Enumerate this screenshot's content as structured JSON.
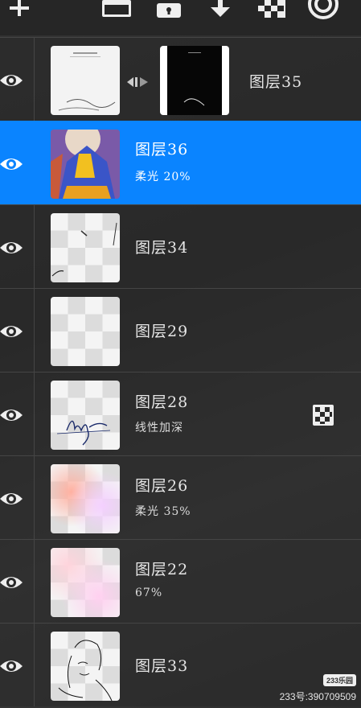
{
  "toolbar": {
    "icons": [
      "plus-icon",
      "layer-fill-icon",
      "lock-icon",
      "merge-down-icon",
      "checkerboard-icon",
      "spiral-icon"
    ]
  },
  "layers": [
    {
      "name": "图层35",
      "sub": "",
      "mask": true,
      "selected": false,
      "badge": false
    },
    {
      "name": "图层36",
      "sub": "柔光  20%",
      "mask": false,
      "selected": true,
      "badge": false
    },
    {
      "name": "图层34",
      "sub": "",
      "mask": false,
      "selected": false,
      "badge": false
    },
    {
      "name": "图层29",
      "sub": "",
      "mask": false,
      "selected": false,
      "badge": false
    },
    {
      "name": "图层28",
      "sub": "线性加深",
      "mask": false,
      "selected": false,
      "badge": true
    },
    {
      "name": "图层26",
      "sub": "柔光  35%",
      "mask": false,
      "selected": false,
      "badge": false
    },
    {
      "name": "图层22",
      "sub": "67%",
      "mask": false,
      "selected": false,
      "badge": false
    },
    {
      "name": "图层33",
      "sub": "",
      "mask": false,
      "selected": false,
      "badge": false
    }
  ],
  "watermark": {
    "badge": "233乐园",
    "text": "233号:390709509"
  },
  "colors": {
    "accent": "#0a84ff",
    "background": "#2a2a2a"
  }
}
